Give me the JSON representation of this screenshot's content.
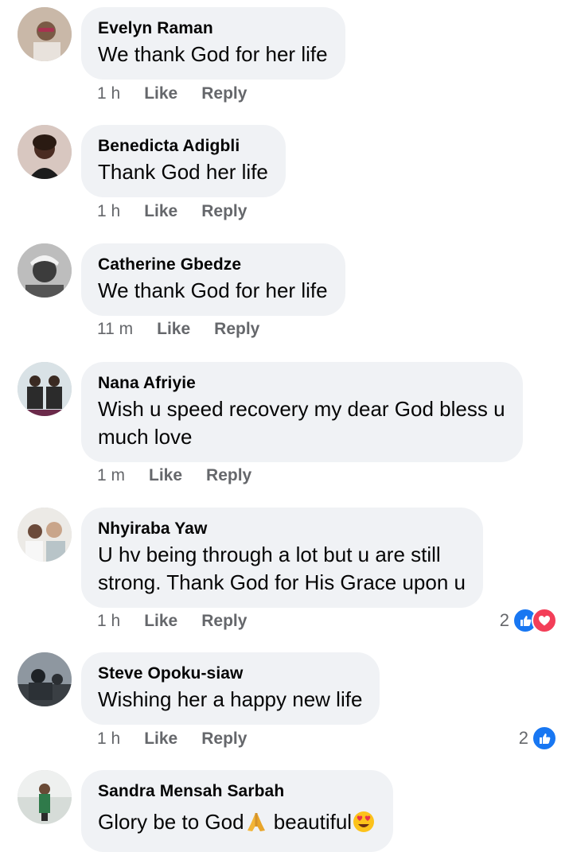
{
  "colors": {
    "bubble_bg": "#f0f2f5",
    "text": "#050505",
    "meta": "#65676b",
    "like_blue": "#1877f2",
    "love_red": "#f33e58"
  },
  "comments": [
    {
      "author": "Evelyn Raman",
      "text": "We thank God for her life",
      "time": "1 h",
      "like": "Like",
      "reply": "Reply"
    },
    {
      "author": "Benedicta Adigbli",
      "text": "Thank God her life",
      "time": "1 h",
      "like": "Like",
      "reply": "Reply"
    },
    {
      "author": "Catherine Gbedze",
      "text": "We thank God for her life",
      "time": "11 m",
      "like": "Like",
      "reply": "Reply"
    },
    {
      "author": "Nana Afriyie",
      "text_line1": "Wish u speed recovery my dear God bless u",
      "text_line2": "much love",
      "time": "1 m",
      "like": "Like",
      "reply": "Reply"
    },
    {
      "author": "Nhyiraba Yaw",
      "text_line1": "U hv being through a lot but u are still",
      "text_line2": "strong. Thank God for His Grace upon u",
      "time": "1 h",
      "like": "Like",
      "reply": "Reply",
      "reaction_count": "2",
      "reactions": [
        "like-icon",
        "love-icon"
      ]
    },
    {
      "author": "Steve Opoku-siaw",
      "text": "Wishing her a happy new life",
      "time": "1 h",
      "like": "Like",
      "reply": "Reply",
      "reaction_count": "2",
      "reactions": [
        "like-icon"
      ]
    },
    {
      "author": "Sandra Mensah Sarbah",
      "text_part1": "Glory be to God",
      "text_part2": " beautiful",
      "emojis": [
        "folded-hands-emoji",
        "heart-eyes-emoji"
      ]
    }
  ]
}
